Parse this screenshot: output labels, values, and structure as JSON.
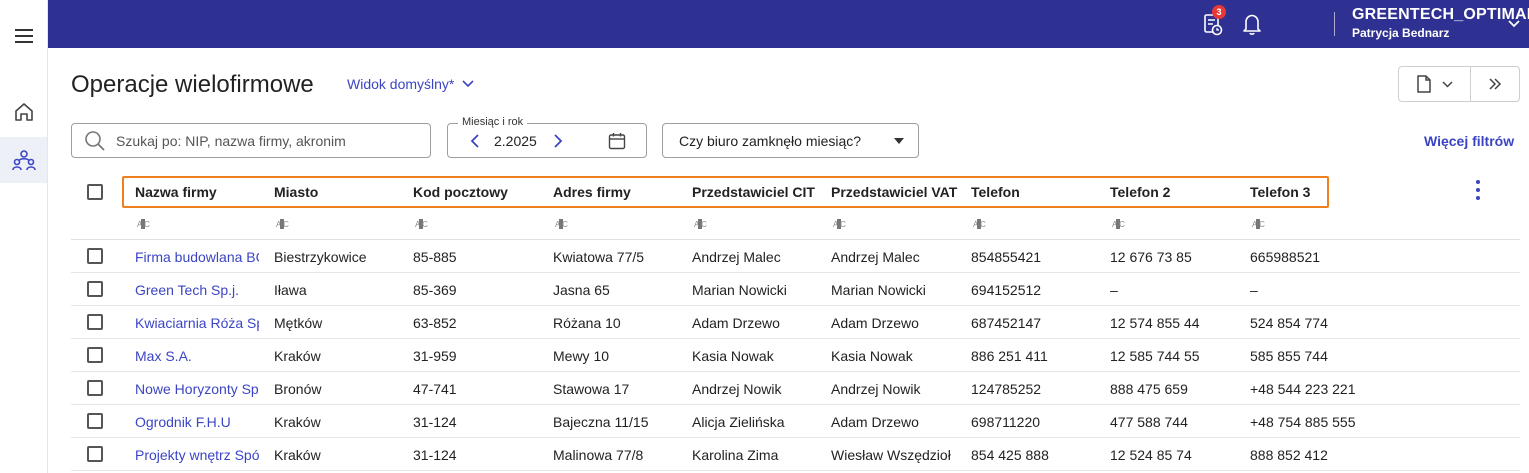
{
  "topbar": {
    "notifications_badge": "3",
    "company_name": "GREENTECH_OPTIMAPROD",
    "user_name": "Patrycja Bednarz"
  },
  "nav": {
    "items": [
      {
        "name": "home",
        "icon": "home-icon"
      },
      {
        "name": "groups",
        "icon": "people-icon"
      }
    ]
  },
  "page": {
    "title": "Operacje wielofirmowe",
    "view_label": "Widok domyślny*"
  },
  "filters": {
    "search_placeholder": "Szukaj po: NIP, nazwa firmy, akronim",
    "month_label": "Miesiąc i rok",
    "month_value": "2.2025",
    "closed_select": "Czy biuro zamknęło miesiąc?",
    "more_filters": "Więcej filtrów"
  },
  "table": {
    "columns": [
      "Nazwa firmy",
      "Miasto",
      "Kod pocztowy",
      "Adres firmy",
      "Przedstawiciel CIT",
      "Przedstawiciel VAT",
      "Telefon",
      "Telefon 2",
      "Telefon 3"
    ],
    "rows": [
      [
        "Firma budowlana BC",
        "Biestrzykowice",
        "85-885",
        "Kwiatowa 77/5",
        "Andrzej Malec",
        "Andrzej Malec",
        "854855421",
        "12 676 73 85",
        "665988521"
      ],
      [
        "Green Tech Sp.j.",
        "Iława",
        "85-369",
        "Jasna 65",
        "Marian Nowicki",
        "Marian Nowicki",
        "694152512",
        "–",
        "–"
      ],
      [
        "Kwiaciarnia Róża Sp",
        "Mętków",
        "63-852",
        "Różana 10",
        "Adam Drzewo",
        "Adam Drzewo",
        "687452147",
        "12 574 855 44",
        "524 854 774"
      ],
      [
        "Max S.A.",
        "Kraków",
        "31-959",
        "Mewy 10",
        "Kasia Nowak",
        "Kasia Nowak",
        "886 251 411",
        "12 585 744 55",
        "585 855 744"
      ],
      [
        "Nowe Horyzonty Sp",
        "Bronów",
        "47-741",
        "Stawowa 17",
        "Andrzej Nowik",
        "Andrzej Nowik",
        "124785252",
        "888 475 659",
        "+48 544 223 221"
      ],
      [
        "Ogrodnik F.H.U",
        "Kraków",
        "31-124",
        "Bajeczna 11/15",
        "Alicja Zielińska",
        "Adam Drzewo",
        "698711220",
        "477 588 744",
        "+48 754 885 555"
      ],
      [
        "Projekty wnętrz Spó",
        "Kraków",
        "31-124",
        "Malinowa 77/8",
        "Karolina Zima",
        "Wiesław Wszędzioł",
        "854 425 888",
        "12 524 85 74",
        "888 852 412"
      ]
    ]
  },
  "colors": {
    "topbar": "#2e3191",
    "accent": "#3b45c4",
    "highlight": "#f0801e"
  }
}
